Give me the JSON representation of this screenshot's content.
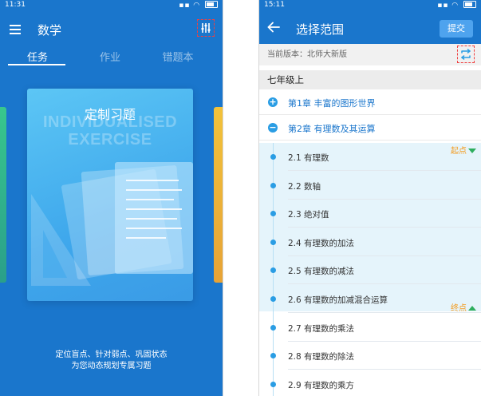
{
  "left_screen": {
    "status_time": "11:31",
    "title": "数学",
    "tabs": [
      "任务",
      "作业",
      "错题本"
    ],
    "card": {
      "title": "定制习题",
      "watermark_line1": "INDIVIDUALISED",
      "watermark_line2": "EXERCISE"
    },
    "footer": {
      "line1": "定位盲点、针对弱点、巩固状态",
      "line2": "为您动态规划专属习题"
    },
    "colors": {
      "primary": "#1a76cc",
      "card": "#4fb6f0",
      "left_card": "#38c78d",
      "right_card": "#f2c23a"
    },
    "icons": [
      "menu-icon",
      "filter-icon"
    ]
  },
  "right_screen": {
    "status_time": "15:11",
    "title": "选择范围",
    "submit_label": "提交",
    "version_text": "当前版本：北师大新版",
    "grade": "七年级上",
    "chapters": [
      {
        "symbol": "+",
        "title": "第1章 丰富的图形世界"
      },
      {
        "symbol": "−",
        "title": "第2章 有理数及其运算"
      }
    ],
    "sections": [
      "2.1 有理数",
      "2.2 数轴",
      "2.3 绝对值",
      "2.4 有理数的加法",
      "2.5 有理数的减法",
      "2.6 有理数的加减混合运算",
      "2.7 有理数的乘法",
      "2.8 有理数的除法",
      "2.9 有理数的乘方"
    ],
    "start_marker": "起点",
    "end_marker": "终点",
    "colors": {
      "primary": "#1a76cc",
      "range_highlight": "#e5f4fb",
      "marker_text": "#f39a1c",
      "marker_arrow": "#2eae5e"
    },
    "icons": [
      "back-arrow-icon",
      "switch-version-icon"
    ]
  }
}
